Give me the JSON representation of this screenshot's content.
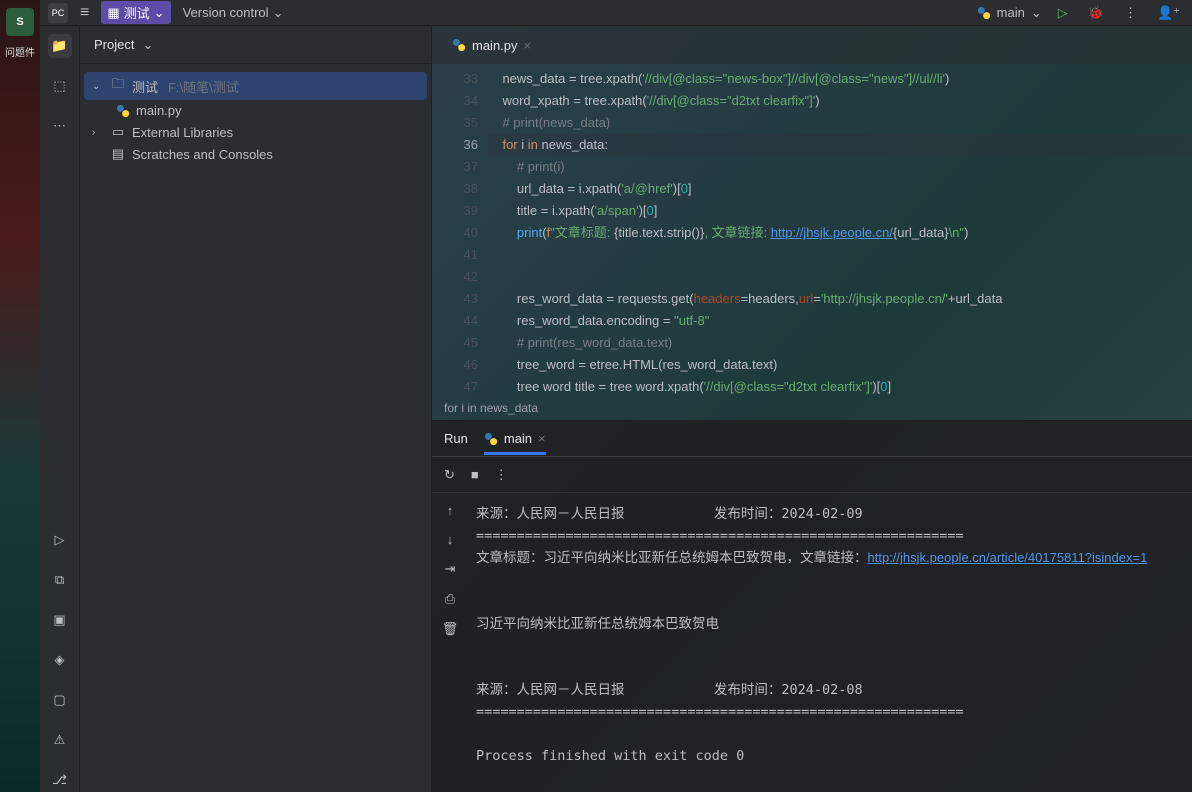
{
  "desktop": {
    "app_label": "S",
    "caption": "问题件"
  },
  "topbar": {
    "project_name": "测试",
    "vcs_label": "Version control",
    "run_config": "main"
  },
  "project_panel": {
    "title": "Project",
    "root_name": "测试",
    "root_path": "F:\\随笔\\测试",
    "file1": "main.py",
    "ext_lib": "External Libraries",
    "scratches": "Scratches and Consoles"
  },
  "editor": {
    "tab_name": "main.py",
    "breadcrumb": "for i in news_data",
    "lines": [
      {
        "n": 33,
        "html": "news_data = tree.xpath(<span class='str'>'//div[@class=\"news-box\"]//div[@class=\"news\"]//ul//li'</span>)"
      },
      {
        "n": 34,
        "html": "word_xpath = tree.xpath(<span class='str'>'//div[@class=\"d2txt clearfix\"]'</span>)"
      },
      {
        "n": 35,
        "html": "<span class='cm'># print(news_data)</span>"
      },
      {
        "n": 36,
        "current": true,
        "html": "<span class='kw'>for</span> i <span class='kw'>in</span> news_data:"
      },
      {
        "n": 37,
        "html": "    <span class='cm'># print(i)</span>"
      },
      {
        "n": 38,
        "html": "    url_data = i.xpath(<span class='str'>'a/@href'</span>)[<span class='num'>0</span>]"
      },
      {
        "n": 39,
        "html": "    title = i.xpath(<span class='str'>'a/span'</span>)[<span class='num'>0</span>]"
      },
      {
        "n": 40,
        "html": "    <span class='fn'>print</span>(<span class='kw'>f</span><span class='str'>\"文章标题: </span>{title.text.strip()}<span class='str'>, 文章链接: </span><span class='link'>http://jhsjk.people.cn/</span>{url_data}<span class='str'>\\n\"</span>)"
      },
      {
        "n": 41,
        "html": ""
      },
      {
        "n": 42,
        "html": ""
      },
      {
        "n": 43,
        "html": "    res_word_data = requests.get(<span style='color:#aa4926'>headers</span>=headers,<span style='color:#aa4926'>url</span>=<span class='str'>'http://jhsjk.people.cn/'</span>+url_data"
      },
      {
        "n": 44,
        "html": "    res_word_data.encoding = <span class='str'>\"utf-8\"</span>"
      },
      {
        "n": 45,
        "html": "    <span class='cm'># print(res_word_data.text)</span>"
      },
      {
        "n": 46,
        "html": "    tree_word = etree.HTML(res_word_data.text)"
      },
      {
        "n": 47,
        "html": "    tree word title = tree word.xpath(<span class='str'>'//div[@class=\"d2txt clearfix\"]'</span>)[<span class='num'>0</span>]"
      }
    ]
  },
  "run_panel": {
    "label": "Run",
    "tab_name": "main",
    "output_html": "来源：人民网－人民日报           发布时间：2024-02-09\n============================================================\n文章标题：习近平向纳米比亚新任总统姆本巴致贺电，文章链接：<a href='#'>http://jhsjk.people.cn/article/40175811?isindex=1</a>\n\n\n习近平向纳米比亚新任总统姆本巴致贺电\n\n\n来源：人民网－人民日报           发布时间：2024-02-08\n============================================================\n\nProcess finished with exit code 0"
  }
}
